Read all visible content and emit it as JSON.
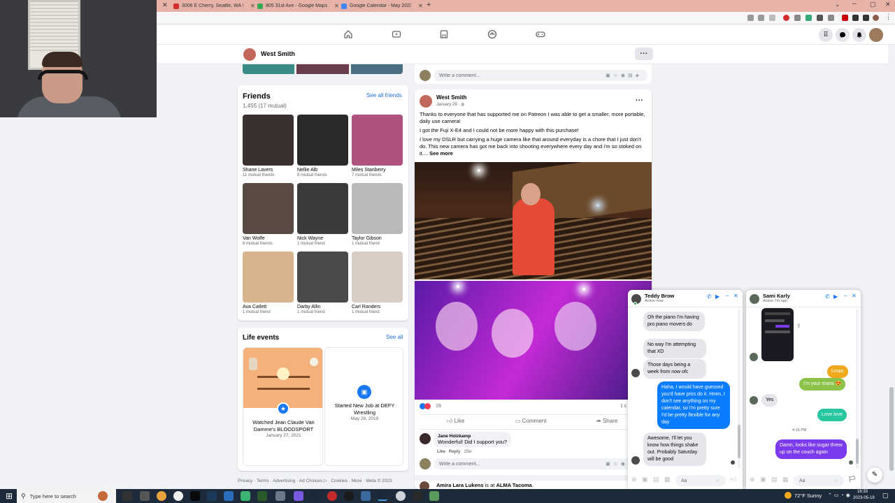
{
  "browser_tabs": [
    {
      "label": "3006 E Cherry, Seattle, WA 98122",
      "color": "#d32f2f"
    },
    {
      "label": "805 31st Ave - Google Maps",
      "color": "#34a853"
    },
    {
      "label": "Google Calendar - May 2023",
      "color": "#4285f4"
    }
  ],
  "new_tab": "+",
  "profile": {
    "name": "West Smith",
    "more": "..."
  },
  "top_comment": {
    "placeholder": "Write a comment..."
  },
  "friends": {
    "title": "Friends",
    "see_all": "See all friends",
    "count": "1,455 (17 mutual)",
    "list": [
      {
        "name": "Shane Lavers",
        "mutual": "11 mutual friends",
        "color": "#3b3030"
      },
      {
        "name": "Nellie Alb",
        "mutual": "8 mutual friends",
        "color": "#2a2a2a"
      },
      {
        "name": "Miles Stanberry",
        "mutual": "7 mutual friends",
        "color": "#b0527f"
      },
      {
        "name": "Van Wolfe",
        "mutual": "6 mutual friends",
        "color": "#5a4a44"
      },
      {
        "name": "Nick Wayne",
        "mutual": "1 mutual friend",
        "color": "#3b3b3b"
      },
      {
        "name": "Taylor Gibson",
        "mutual": "1 mutual friend",
        "color": "#b9b9b9"
      },
      {
        "name": "Ava Catlett",
        "mutual": "1 mutual friend",
        "color": "#d8b48c"
      },
      {
        "name": "Darby Allin",
        "mutual": "1 mutual friend",
        "color": "#4a4a4a"
      },
      {
        "name": "Carl Randers",
        "mutual": "1 mutual friend",
        "color": "#d7cdc5"
      }
    ]
  },
  "life_events": {
    "title": "Life events",
    "see_all": "See all",
    "events": [
      {
        "title": "Watched Jean Claude Van Damme's BLOODSPORT",
        "date": "January 27, 2021"
      },
      {
        "title": "Started New Job at DEFY Wrestling",
        "date": "May 28, 2018"
      }
    ]
  },
  "footer": {
    "text": "Privacy · Terms · Advertising · Ad Choices ▷ · Cookies · More · Meta © 2023"
  },
  "post": {
    "author": "West Smith",
    "date": "January 28 · ",
    "more": "...",
    "p1": "Thanks to everyone that has supported me on Patreon I was able to get a smaller, more portable, daily use camera!",
    "p2": "I got the Fuji X-E4 and I could not be more happy with this purchase!",
    "p3": "I love my DSLR but carrying a huge camera like that around everyday is a chore that I just don't do. This new camera has got me back into shooting everywhere every day and i'm so stoked on it.... ",
    "see_more": "See more",
    "reaction_count": "19",
    "comment_count": "1 c",
    "like": "Like",
    "comment": "Comment",
    "share": "Share",
    "reply": {
      "author": "Jane Holzkamp",
      "text": "Wonderful! Did I support you?",
      "like": "Like",
      "reply": "Reply",
      "age": "15w"
    },
    "comment_placeholder": "Write a comment..."
  },
  "next_post": {
    "author": "Amira Lara Lukens",
    "action": " is at ",
    "place": "ALMA Tacoma",
    "end": "."
  },
  "chat1": {
    "name": "Teddy Brow",
    "status": "Active now",
    "messages": [
      {
        "dir": "in",
        "text": "Oh the piano I'm having pro piano movers do"
      },
      {
        "dir": "in",
        "text": "No way I'm attempting that XD"
      },
      {
        "dir": "in",
        "text": "Those days being a week from now ofc"
      },
      {
        "dir": "out",
        "text": "Haha, I would have guessed you'd have pros do it. Hmm, I don't see anything on my calendar, so I'm pretty sure I'd be pretty flexible for any day"
      },
      {
        "dir": "in",
        "text": "Awesome, I'll let you know how things shake out. Probably Saturday will be good"
      }
    ],
    "input_placeholder": "Aa"
  },
  "chat2": {
    "name": "Sami Karly",
    "status": "Active 7m ago",
    "messages": [
      {
        "dir": "out",
        "text": "Lmao",
        "color": "#f0a81c"
      },
      {
        "dir": "out",
        "text": "I'm your mans 😍",
        "color": "#8bc34a"
      },
      {
        "dir": "in",
        "text": "Yes"
      },
      {
        "dir": "out",
        "text": "Love love",
        "color": "#26c6a0"
      },
      {
        "dir": "out",
        "text": "Damn, looks like sugar threw up on the couch again",
        "color": "#7c3aed"
      }
    ],
    "time_divider": "4:16 PM",
    "input_placeholder": "Aa"
  },
  "taskbar": {
    "search_placeholder": "Type here to search",
    "weather": "72°F  Sunny",
    "time": "16:33",
    "date": "2023-05-19"
  }
}
